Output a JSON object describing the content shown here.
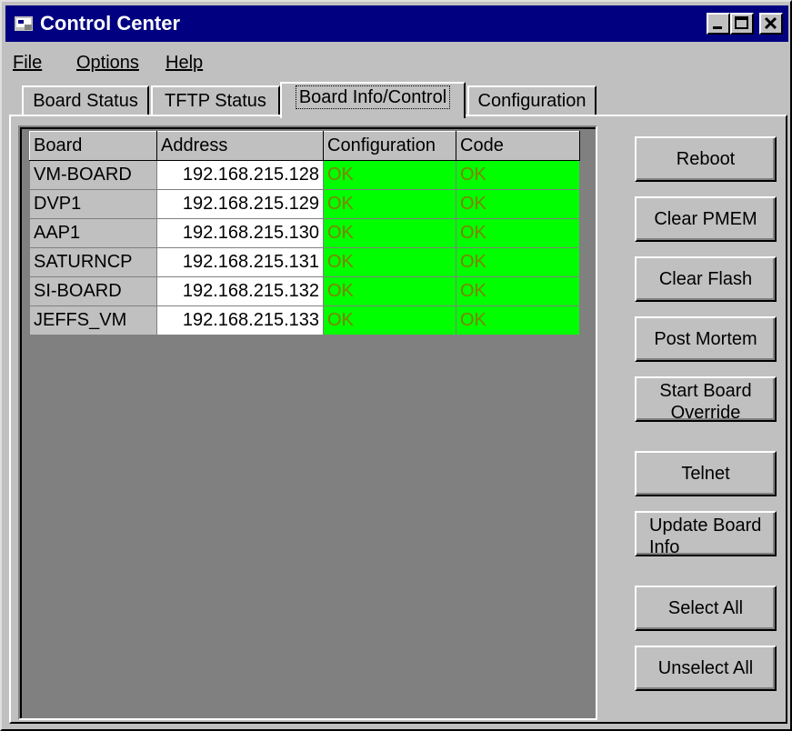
{
  "window": {
    "title": "Control Center",
    "controls": [
      "minimize",
      "maximize",
      "close"
    ]
  },
  "menu": {
    "file": "File",
    "options": "Options",
    "help": "Help"
  },
  "tabs": [
    {
      "label": "Board Status",
      "active": false
    },
    {
      "label": "TFTP Status",
      "active": false
    },
    {
      "label": "Board Info/Control",
      "active": true
    },
    {
      "label": "Configuration",
      "active": false
    }
  ],
  "table": {
    "headers": [
      "Board",
      "Address",
      "Configuration",
      "Code"
    ],
    "rows": [
      {
        "board": "VM-BOARD",
        "address": "192.168.215.128",
        "configuration": "OK",
        "code": "OK"
      },
      {
        "board": "DVP1",
        "address": "192.168.215.129",
        "configuration": "OK",
        "code": "OK"
      },
      {
        "board": "AAP1",
        "address": "192.168.215.130",
        "configuration": "OK",
        "code": "OK"
      },
      {
        "board": "SATURNCP",
        "address": "192.168.215.131",
        "configuration": "OK",
        "code": "OK"
      },
      {
        "board": "SI-BOARD",
        "address": "192.168.215.132",
        "configuration": "OK",
        "code": "OK"
      },
      {
        "board": "JEFFS_VM",
        "address": "192.168.215.133",
        "configuration": "OK",
        "code": "OK"
      }
    ]
  },
  "buttons": {
    "reboot": "Reboot",
    "clear_pmem": "Clear PMEM",
    "clear_flash": "Clear Flash",
    "post_mortem": "Post Mortem",
    "start_board_override": "Start Board\nOverride",
    "telnet": "Telnet",
    "update_board_info": "Update Board\nInfo",
    "select_all": "Select All",
    "unselect_all": "Unselect All"
  },
  "colors": {
    "titlebar": "#000080",
    "window": "#c0c0c0",
    "ok_cell": "#00ff00",
    "ok_text": "#808000",
    "grid_background": "#808080"
  }
}
